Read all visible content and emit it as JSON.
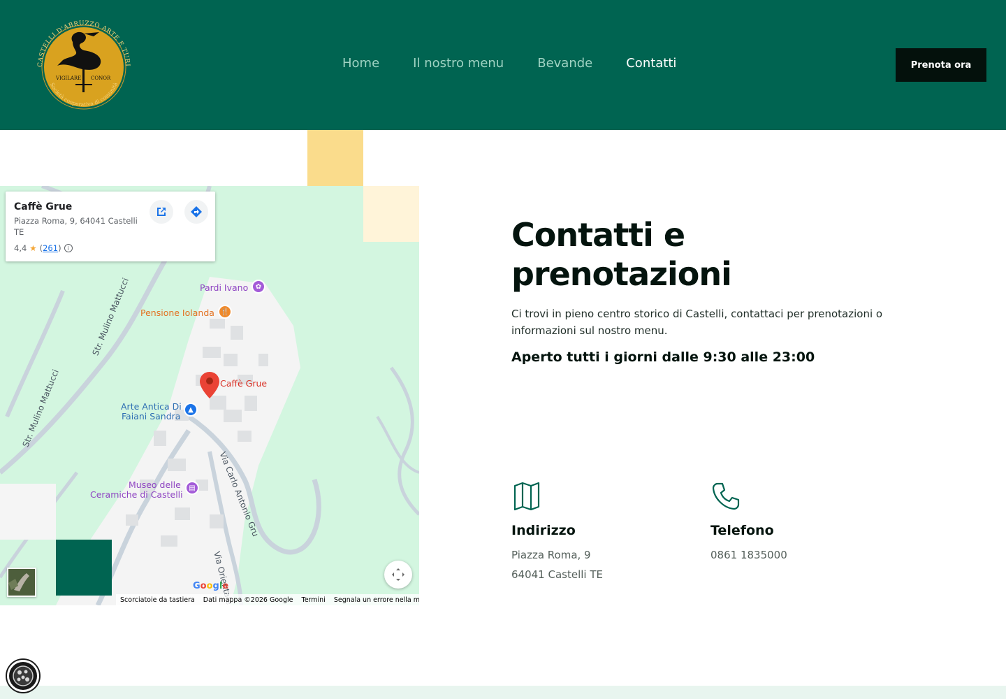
{
  "header": {
    "logo": {
      "ring_text": "CASTELLI D'ABRUZZO ARTE E TURISMO",
      "motto_left": "VIGILARE",
      "motto_right": "CONOR",
      "bottom_text": "Società cooperativa di comunità"
    },
    "nav": [
      {
        "label": "Home",
        "active": false
      },
      {
        "label": "Il nostro menu",
        "active": false
      },
      {
        "label": "Bevande",
        "active": false
      },
      {
        "label": "Contatti",
        "active": true
      }
    ],
    "cta_label": "Prenota ora"
  },
  "map": {
    "card": {
      "name": "Caffè Grue",
      "address": "Piazza Roma, 9, 64041 Castelli TE",
      "rating": "4,4",
      "reviews": "261"
    },
    "pois": {
      "pardi": "Pardi Ivano",
      "pensione": "Pensione Iolanda",
      "caffe": "Caffè Grue",
      "arte_1": "Arte Antica Di",
      "arte_2": "Faiani Sandra",
      "museo_1": "Museo delle",
      "museo_2": "Ceramiche di Castelli"
    },
    "roads": {
      "mulino_1": "Str. Mulino Mattucci",
      "mulino_2": "Str. Mulino Mattucci",
      "carlo": "Via Carlo Antonio Gru",
      "orientale": "Via Orientale"
    },
    "google": "Google",
    "attribution": [
      "Scorciatoie da tastiera",
      "Dati mappa ©2026 Google",
      "Termini",
      "Segnala un errore nella mappa"
    ]
  },
  "content": {
    "title_1": "Contatti e",
    "title_2": "prenotazioni",
    "description": "Ci trovi in pieno centro storico di Castelli, contattaci per prenotazioni o informazioni sul nostro menu.",
    "hours": "Aperto tutti i giorni dalle 9:30 alle 23:00",
    "address": {
      "label": "Indirizzo",
      "line1": "Piazza Roma, 9",
      "line2": "64041 Castelli TE"
    },
    "phone": {
      "label": "Telefono",
      "value": "0861 1835000"
    }
  },
  "colors": {
    "brand_green": "#006451",
    "yellow": "#fadc8c",
    "cream": "#fff4d9",
    "cta_bg": "#04110c"
  }
}
